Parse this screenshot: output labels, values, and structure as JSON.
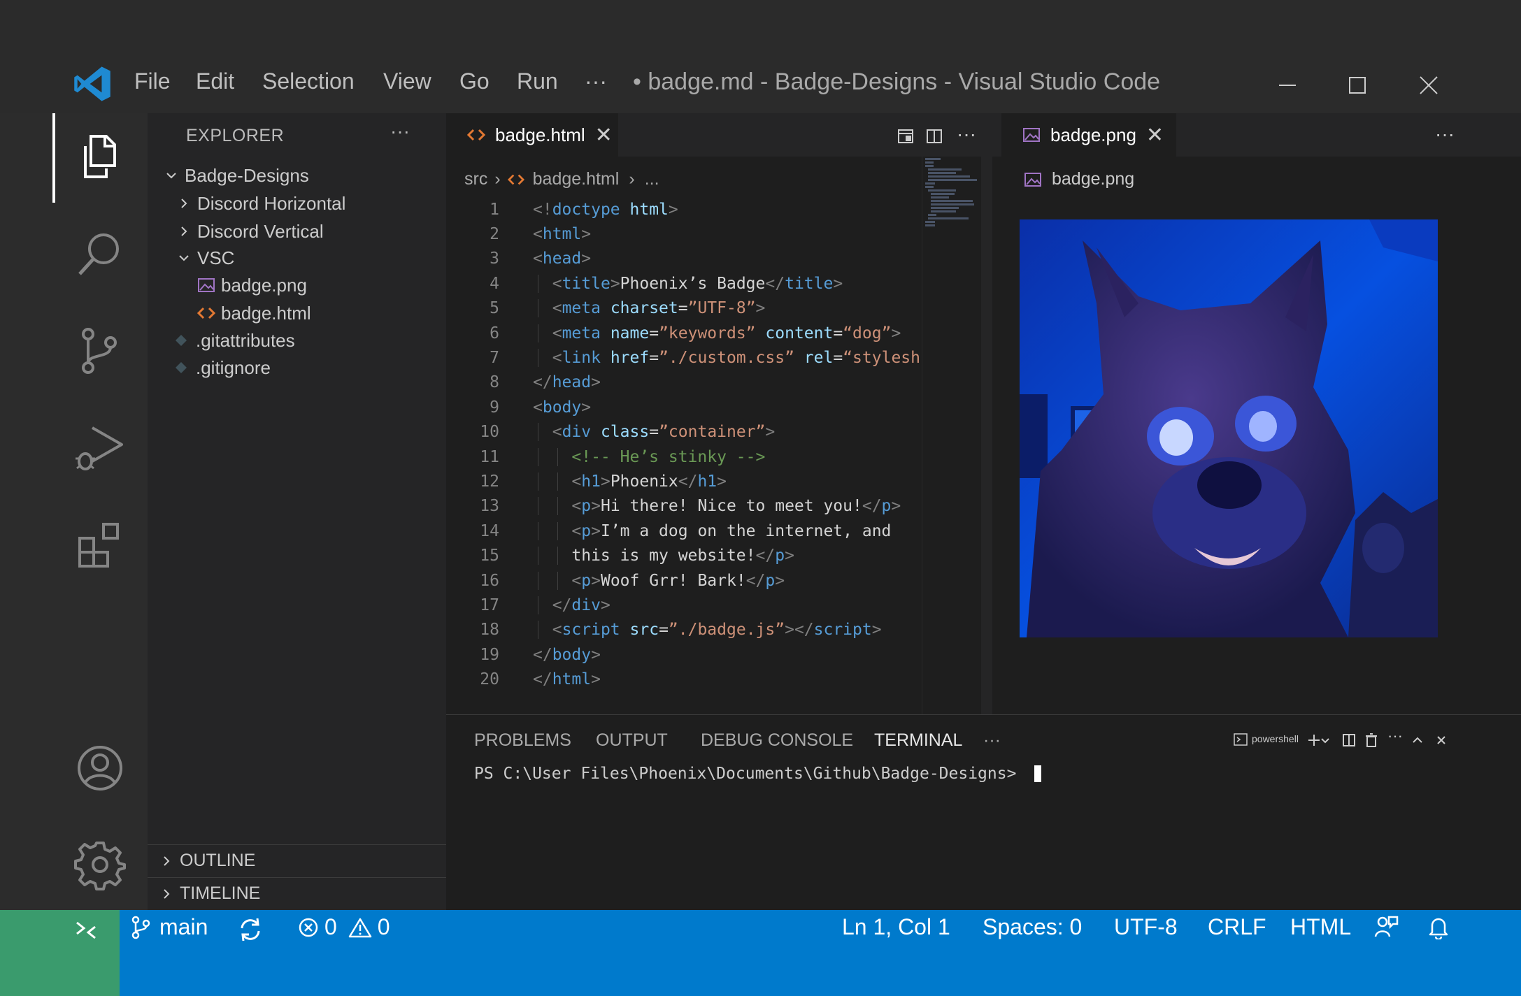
{
  "menu": [
    "File",
    "Edit",
    "Selection",
    "View",
    "Go",
    "Run",
    "···"
  ],
  "window_title": "• badge.md - Badge-Designs - Visual Studio Code",
  "activity": [
    "explorer-icon",
    "search-icon",
    "source-control-icon",
    "run-debug-icon",
    "extensions-icon",
    "account-icon",
    "gear-icon"
  ],
  "sidebar": {
    "title": "EXPLORER",
    "more": "···",
    "tree": [
      {
        "label": "Badge-Designs",
        "kind": "folder-open"
      },
      {
        "label": "Discord Horizontal",
        "kind": "folder"
      },
      {
        "label": "Discord Vertical",
        "kind": "folder"
      },
      {
        "label": "VSC",
        "kind": "folder-open"
      },
      {
        "label": "badge.png",
        "kind": "image"
      },
      {
        "label": "badge.html",
        "kind": "html"
      },
      {
        "label": ".gitattributes",
        "kind": "git"
      },
      {
        "label": ".gitignore",
        "kind": "git"
      }
    ],
    "outline": "OUTLINE",
    "timeline": "TIMELINE"
  },
  "editor_left": {
    "tab": "badge.html",
    "tab_close": "✕",
    "breadcrumb": {
      "root": "src",
      "file": "badge.html",
      "tail": "..."
    },
    "more": "···"
  },
  "editor_right": {
    "tab": "badge.png",
    "tab_close": "✕",
    "breadcrumb": "badge.png",
    "more": "···"
  },
  "panel": {
    "tabs": [
      "PROBLEMS",
      "OUTPUT",
      "DEBUG CONSOLE",
      "TERMINAL"
    ],
    "more": "···",
    "shell": "powershell",
    "terminal_line": "PS C:\\User Files\\Phoenix\\Documents\\Github\\Badge-Designs> "
  },
  "status": {
    "branch": "main",
    "errors": "0",
    "warnings": "0",
    "position": "Ln 1, Col 1",
    "spaces": "Spaces: 0",
    "encoding": "UTF-8",
    "eol": "CRLF",
    "language": "HTML"
  },
  "colors": {
    "statusbar": "#007acc",
    "remote": "#3a9b6d",
    "editor_bg": "#1e1e1e",
    "sidebar_bg": "#252526"
  }
}
